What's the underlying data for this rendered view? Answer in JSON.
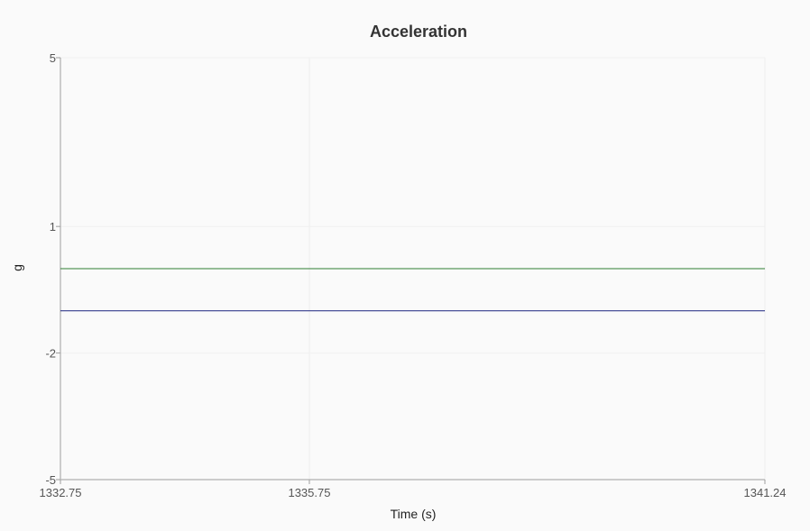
{
  "chart_data": {
    "type": "line",
    "title": "Acceleration",
    "xlabel": "Time (s)",
    "ylabel": "g",
    "xlim": [
      1332.75,
      1341.24
    ],
    "ylim": [
      -5,
      5
    ],
    "x_ticks": [
      {
        "value": 1332.75,
        "label": "1332.75"
      },
      {
        "value": 1335.75,
        "label": "1335.75"
      },
      {
        "value": 1341.24,
        "label": "1341.24"
      }
    ],
    "y_ticks": [
      {
        "value": 5,
        "label": "5"
      },
      {
        "value": 1,
        "label": "1"
      },
      {
        "value": -2,
        "label": "-2"
      },
      {
        "value": -5,
        "label": "-5"
      }
    ],
    "grid": true,
    "legend": "none",
    "series": [
      {
        "color": "#2e7d32",
        "x": [
          1332.75,
          1341.24
        ],
        "y": [
          0,
          0
        ]
      },
      {
        "color": "#1a237e",
        "x": [
          1332.75,
          1341.24
        ],
        "y": [
          -1,
          -1
        ]
      }
    ]
  }
}
